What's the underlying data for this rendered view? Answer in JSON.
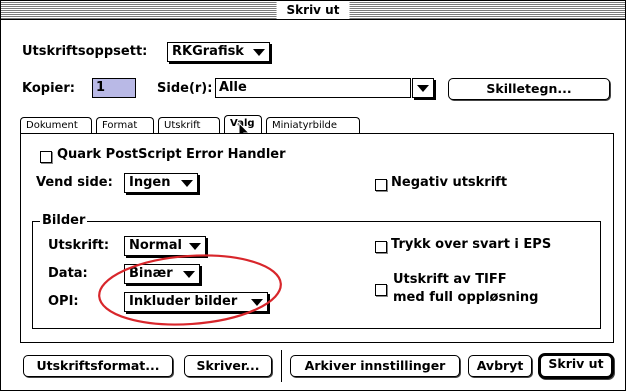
{
  "window": {
    "title": "Skriv ut"
  },
  "setup": {
    "label": "Utskriftsoppsett:",
    "value": "RKGrafisk"
  },
  "copies": {
    "label": "Kopier:",
    "value": "1"
  },
  "pages": {
    "label": "Side(r):",
    "value": "Alle"
  },
  "separator_button": "Skilletegn...",
  "tabs": [
    {
      "label": "Dokument"
    },
    {
      "label": "Format"
    },
    {
      "label": "Utskrift"
    },
    {
      "label": "Valg"
    },
    {
      "label": "Miniatyrbilde"
    }
  ],
  "options": {
    "error_handler": "Quark PostScript Error Handler",
    "flip_label": "Vend side:",
    "flip_value": "Ingen",
    "negative": "Negativ utskrift"
  },
  "images": {
    "group_label": "Bilder",
    "print_label": "Utskrift:",
    "print_value": "Normal",
    "data_label": "Data:",
    "data_value": "Binær",
    "opi_label": "OPI:",
    "opi_value": "Inkluder bilder",
    "overprint_eps": "Trykk over svart i EPS",
    "tiff_line1": "Utskrift av TIFF",
    "tiff_line2": "med full oppløsning"
  },
  "footer": {
    "page_format": "Utskriftsformat...",
    "printer": "Skriver...",
    "save_settings": "Arkiver innstillinger",
    "cancel": "Avbryt",
    "print": "Skriv ut"
  },
  "colors": {
    "highlight_circle": "#d8262b",
    "copies_field": "#b9b9e6"
  }
}
